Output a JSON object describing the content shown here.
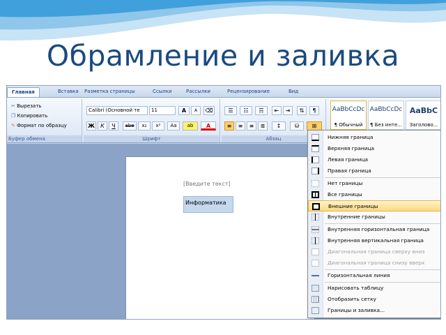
{
  "slide": {
    "title": "Обрамление и заливка"
  },
  "tabs": [
    "Главная",
    "Вставка",
    "Разметка страницы",
    "Ссылки",
    "Рассылки",
    "Рецензирование",
    "Вид"
  ],
  "clipboard": {
    "cut": "Вырезать",
    "copy": "Копировать",
    "format_painter": "Формат по образцу",
    "label": "Буфер обмена"
  },
  "font": {
    "family": "Calibri (Основной те",
    "size": "11",
    "grow": "A",
    "shrink": "A",
    "bold": "Ж",
    "italic": "К",
    "underline": "Ч",
    "strike": "abe",
    "subscript": "x₂",
    "superscript": "x²",
    "aa": "Aa",
    "highlight": "ab",
    "color": "A",
    "label": "Шрифт"
  },
  "paragraph": {
    "label": "Абзац"
  },
  "styles": [
    {
      "preview": "AaBbCcDc",
      "name": "¶ Обычный"
    },
    {
      "preview": "AaBbCcDc",
      "name": "¶ Без инте..."
    },
    {
      "preview": "AaBbC",
      "name": "Заголово..."
    }
  ],
  "document": {
    "placeholder": "[Введите текст]",
    "field_text": "Информатика"
  },
  "border_menu": {
    "items": [
      {
        "label": "Нижняя граница"
      },
      {
        "label": "Верхняя граница"
      },
      {
        "label": "Левая граница"
      },
      {
        "label": "Правая граница"
      },
      {
        "label": "Нет границы"
      },
      {
        "label": "Все границы"
      },
      {
        "label": "Внешние границы"
      },
      {
        "label": "Внутренние границы"
      },
      {
        "label": "Внутренняя горизонтальная граница"
      },
      {
        "label": "Внутренняя вертикальная граница"
      },
      {
        "label": "Диагональная граница сверху вниз"
      },
      {
        "label": "Диагональная граница снизу вверх"
      },
      {
        "label": "Горизонтальная линия"
      },
      {
        "label": "Нарисовать таблицу"
      },
      {
        "label": "Отобразить сетку"
      },
      {
        "label": "Границы и заливка..."
      }
    ],
    "highlighted": "Внешние границы"
  },
  "colors": {
    "title": "#1a4a80",
    "accent": "#15428b",
    "highlight": "#ffd884",
    "doc_bg": "#8aa3c6"
  }
}
